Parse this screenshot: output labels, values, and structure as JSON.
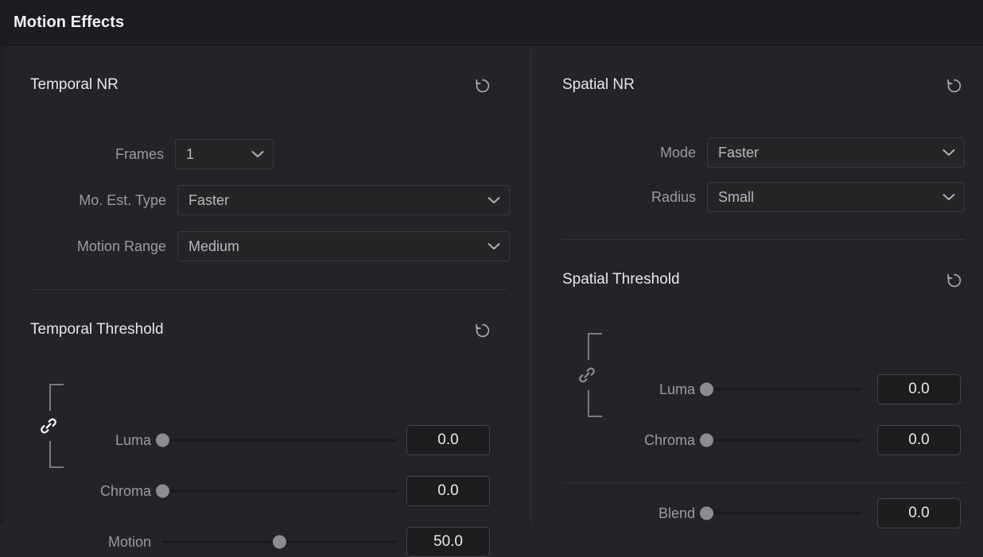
{
  "window": {
    "title": "Motion Effects"
  },
  "icons": {
    "reset": "reset-arrow-icon",
    "chevron": "chevron-down-icon",
    "link": "link-chain-icon"
  },
  "colors": {
    "titlebar_bg": "#1c1c21",
    "body_bg": "#232329",
    "control_bg": "#252528",
    "valuebox_bg": "#1d1d20",
    "slider_handle": "#8d8d90",
    "slider_track": "#19191c",
    "label_text": "#9b9b9f",
    "value_text": "#e9e9ec",
    "heading_text": "#e8e8ea",
    "link_active": "#ffffff",
    "link_inactive": "#8a8a90"
  },
  "left_panel": {
    "temporal_nr": {
      "title": "Temporal NR",
      "reset_label": "Reset Temporal NR",
      "fields": [
        {
          "label": "Frames",
          "value": "1",
          "type": "dropdown",
          "name": "frames"
        },
        {
          "label": "Mo. Est. Type",
          "value": "Faster",
          "type": "dropdown",
          "name": "motion-estimation-type"
        },
        {
          "label": "Motion Range",
          "value": "Medium",
          "type": "dropdown",
          "name": "motion-range"
        }
      ]
    },
    "temporal_threshold": {
      "title": "Temporal Threshold",
      "reset_label": "Reset Temporal Threshold",
      "link_state": "linked",
      "sliders": [
        {
          "label": "Luma",
          "value": "0.0",
          "percent": 0,
          "name": "luma"
        },
        {
          "label": "Chroma",
          "value": "0.0",
          "percent": 0,
          "name": "chroma"
        },
        {
          "label": "Motion",
          "value": "50.0",
          "percent": 50,
          "name": "motion"
        }
      ]
    }
  },
  "right_panel": {
    "spatial_nr": {
      "title": "Spatial NR",
      "reset_label": "Reset Spatial NR",
      "fields": [
        {
          "label": "Mode",
          "value": "Faster",
          "type": "dropdown",
          "name": "mode"
        },
        {
          "label": "Radius",
          "value": "Small",
          "type": "dropdown",
          "name": "radius"
        }
      ]
    },
    "spatial_threshold": {
      "title": "Spatial Threshold",
      "reset_label": "Reset Spatial Threshold",
      "link_state": "unlinked",
      "sliders": [
        {
          "label": "Luma",
          "value": "0.0",
          "percent": 0,
          "name": "luma"
        },
        {
          "label": "Chroma",
          "value": "0.0",
          "percent": 0,
          "name": "chroma"
        }
      ]
    },
    "blend": {
      "sliders": [
        {
          "label": "Blend",
          "value": "0.0",
          "percent": 0,
          "name": "blend"
        }
      ]
    }
  }
}
